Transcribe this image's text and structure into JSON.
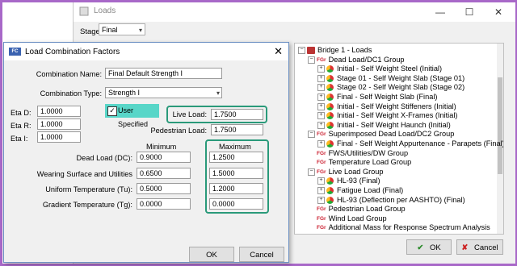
{
  "loads_window": {
    "title": "Loads",
    "minimize": "—",
    "maximize": "☐",
    "close": "✕",
    "stage_label": "Stage:",
    "stage_value": "Final",
    "ok_label": "OK",
    "cancel_label": "Cancel"
  },
  "tree": [
    {
      "text": "Bridge 1 - Loads",
      "icon": "bridge-icon",
      "level": 0,
      "expander": "−"
    },
    {
      "text": "Dead Load/DC1 Group",
      "icon": "group-icon",
      "level": 1,
      "expander": "−"
    },
    {
      "text": "Initial - Self Weight Steel  (Initial)",
      "icon": "loadcase-icon",
      "level": 2,
      "expander": "+"
    },
    {
      "text": "Stage 01 - Self Weight Slab  (Stage 01)",
      "icon": "loadcase-icon",
      "level": 2,
      "expander": "+"
    },
    {
      "text": "Stage 02 - Self Weight Slab  (Stage 02)",
      "icon": "loadcase-icon",
      "level": 2,
      "expander": "+"
    },
    {
      "text": "Final - Self Weight Slab  (Final)",
      "icon": "loadcase-icon",
      "level": 2,
      "expander": "+"
    },
    {
      "text": "Initial - Self Weight Stiffeners  (Initial)",
      "icon": "loadcase-icon",
      "level": 2,
      "expander": "+"
    },
    {
      "text": "Initial - Self Weight X-Frames  (Initial)",
      "icon": "loadcase-icon",
      "level": 2,
      "expander": "+"
    },
    {
      "text": "Initial - Self Weight Haunch  (Initial)",
      "icon": "loadcase-icon",
      "level": 2,
      "expander": "+"
    },
    {
      "text": "Superimposed Dead Load/DC2 Group",
      "icon": "group-icon",
      "level": 1,
      "expander": "−"
    },
    {
      "text": "Final - Self Weight Appurtenance - Parapets  (Final)",
      "icon": "loadcase-icon",
      "level": 2,
      "expander": "+"
    },
    {
      "text": "FWS/Utilities/DW Group",
      "icon": "group-icon",
      "level": 1,
      "expander": ""
    },
    {
      "text": "Temperature Load Group",
      "icon": "group-icon",
      "level": 1,
      "expander": ""
    },
    {
      "text": "Live Load Group",
      "icon": "group-icon",
      "level": 1,
      "expander": "−"
    },
    {
      "text": "HL-93  (Final)",
      "icon": "loadcase-icon",
      "level": 2,
      "expander": "+"
    },
    {
      "text": "Fatigue Load  (Final)",
      "icon": "loadcase-icon",
      "level": 2,
      "expander": "+"
    },
    {
      "text": "HL-93 (Deflection per AASHTO)  (Final)",
      "icon": "loadcase-icon",
      "level": 2,
      "expander": "+"
    },
    {
      "text": "Pedestrian Load Group",
      "icon": "group-icon",
      "level": 1,
      "expander": ""
    },
    {
      "text": "Wind Load Group",
      "icon": "group-icon",
      "level": 1,
      "expander": ""
    },
    {
      "text": "Additional Mass for Response Spectrum Analysis",
      "icon": "group-icon",
      "level": 1,
      "expander": ""
    }
  ],
  "dialog": {
    "title": "Load Combination Factors",
    "close": "✕",
    "combination_name_label": "Combination Name:",
    "combination_name_value": "Final Default Strength I",
    "combination_type_label": "Combination Type:",
    "combination_type_value": "Strength I",
    "eta_d_label": "Eta D:",
    "eta_d_value": "1.0000",
    "eta_r_label": "Eta R:",
    "eta_r_value": "1.0000",
    "eta_i_label": "Eta I:",
    "eta_i_value": "1.0000",
    "user_specified_label": "User Specified",
    "user_specified_checked": "✓",
    "live_load_label": "Live Load:",
    "live_load_value": "1.7500",
    "pedestrian_load_label": "Pedestrian Load:",
    "pedestrian_load_value": "1.7500",
    "minimum_header": "Minimum",
    "maximum_header": "Maximum",
    "factors": [
      {
        "label": "Dead Load (DC):",
        "min": "0.9000",
        "max": "1.2500"
      },
      {
        "label": "Wearing Surface and Utilities",
        "min": "0.6500",
        "max": "1.5000"
      },
      {
        "label": "Uniform Temperature (Tu):",
        "min": "0.5000",
        "max": "1.2000"
      },
      {
        "label": "Gradient Temperature (Tg):",
        "min": "0.0000",
        "max": "0.0000"
      }
    ],
    "ok_label": "OK",
    "cancel_label": "Cancel"
  },
  "colors": {
    "highlight_border": "#2a9a7a",
    "user_specified_bg": "#58d6c8",
    "frame_border": "#a868c8"
  }
}
